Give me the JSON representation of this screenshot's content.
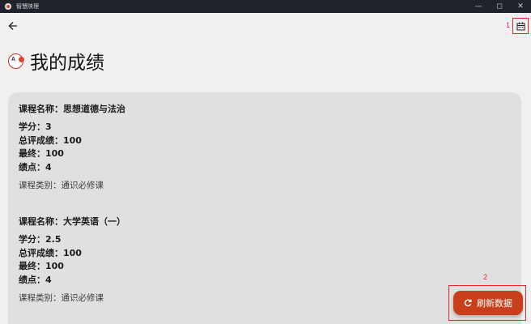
{
  "window": {
    "title": "智慧陕理"
  },
  "header": {
    "title": "我的成绩"
  },
  "annotations": {
    "calendar": "1",
    "refresh": "2"
  },
  "courses": [
    {
      "name": "课程名称：思想道德与法治",
      "credit": "学分：3",
      "total": "总评成绩：100",
      "final": "最终：100",
      "gpa": "绩点：4",
      "category": "课程类别：通识必修课"
    },
    {
      "name": "课程名称：大学英语（一）",
      "credit": "学分：2.5",
      "total": "总评成绩：100",
      "final": "最终：100",
      "gpa": "绩点：4",
      "category": "课程类别：通识必修课"
    }
  ],
  "refresh": {
    "label": "刷新数据"
  },
  "colors": {
    "accent": "#c8401b",
    "annotation": "#e8262b",
    "titlebar": "#20232a"
  }
}
